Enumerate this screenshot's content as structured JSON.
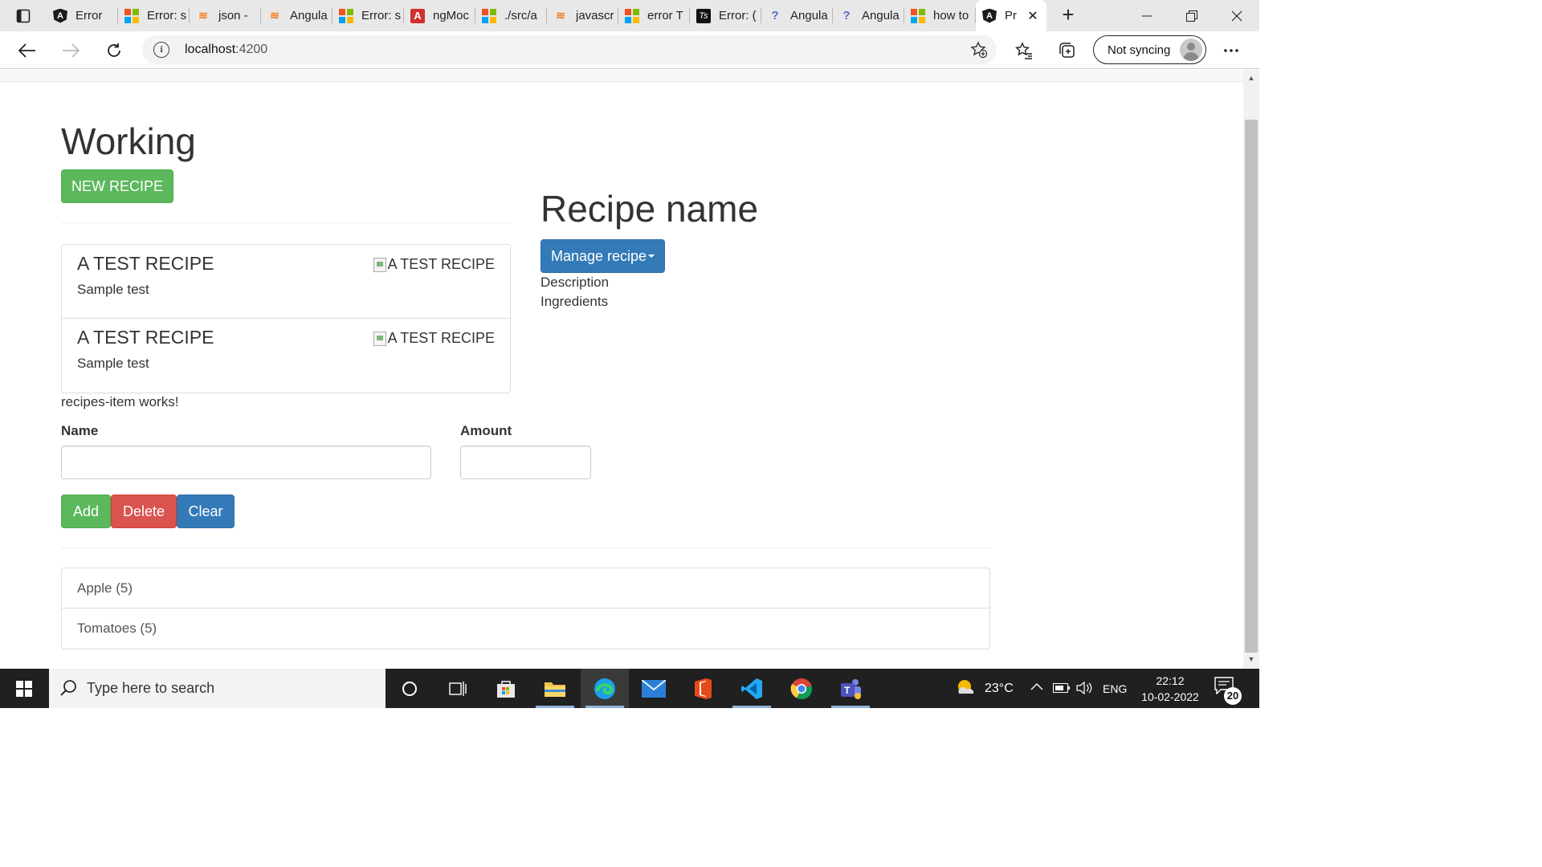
{
  "browser": {
    "tabs": [
      {
        "title": "Error",
        "icon": "angular-icon"
      },
      {
        "title": "Error: s",
        "icon": "microsoft-icon"
      },
      {
        "title": "json - ",
        "icon": "stackoverflow-icon"
      },
      {
        "title": "Angula",
        "icon": "stackoverflow-icon"
      },
      {
        "title": "Error: s",
        "icon": "microsoft-icon"
      },
      {
        "title": "ngMoc",
        "icon": "angular-red-icon"
      },
      {
        "title": "./src/a",
        "icon": "microsoft-icon"
      },
      {
        "title": "javascr",
        "icon": "stackoverflow-icon"
      },
      {
        "title": "error T",
        "icon": "microsoft-icon"
      },
      {
        "title": "Error: (",
        "icon": "typescript-icon"
      },
      {
        "title": "Angula",
        "icon": "question-icon"
      },
      {
        "title": "Angula",
        "icon": "question-icon"
      },
      {
        "title": "how to",
        "icon": "microsoft-icon"
      }
    ],
    "active_tab": {
      "title": "Pr",
      "icon": "angular-icon"
    },
    "url_host": "localhost",
    "url_port": ":4200",
    "profile_label": "Not syncing"
  },
  "app": {
    "heading": "Working",
    "new_recipe_label": "NEW RECIPE",
    "recipes": [
      {
        "name": "A TEST RECIPE",
        "description": "Sample test",
        "image_alt": "A TEST RECIPE"
      },
      {
        "name": "A TEST RECIPE",
        "description": "Sample test",
        "image_alt": "A TEST RECIPE"
      }
    ],
    "recipes_item_text": "recipes-item works!",
    "detail": {
      "title": "Recipe name",
      "manage_label": "Manage recipe",
      "description_label": "Description",
      "ingredients_label": "Ingredients"
    },
    "shopping_edit": {
      "name_label": "Name",
      "amount_label": "Amount",
      "name_value": "",
      "amount_value": "",
      "add_label": "Add",
      "delete_label": "Delete",
      "clear_label": "Clear"
    },
    "shopping_list": [
      {
        "text": "Apple (5)"
      },
      {
        "text": "Tomatoes (5)"
      }
    ]
  },
  "taskbar": {
    "search_placeholder": "Type here to search",
    "weather": "23°C",
    "language": "ENG",
    "time": "22:12",
    "date": "10-02-2022",
    "notification_count": "20"
  },
  "colors": {
    "success": "#5cb85c",
    "danger": "#d9534f",
    "primary": "#337ab7",
    "taskbar": "#202020"
  }
}
